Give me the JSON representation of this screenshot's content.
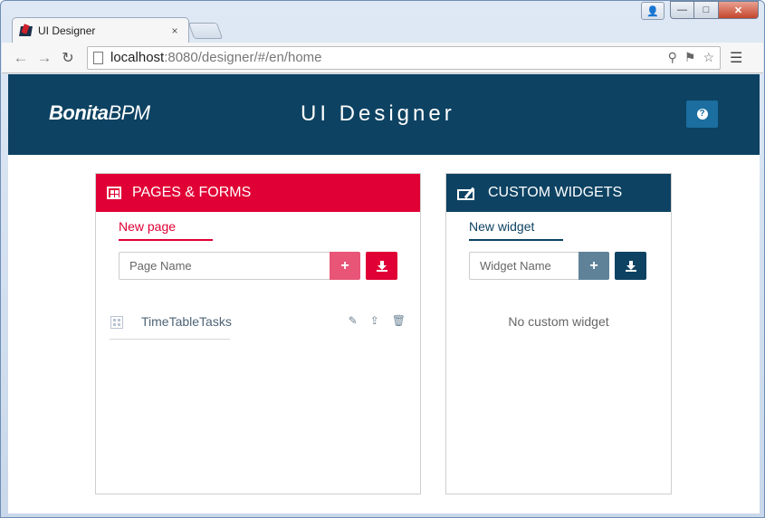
{
  "browser": {
    "tab_title": "UI Designer",
    "tab_close": "×",
    "url_host": "localhost",
    "url_rest": ":8080/designer/#/en/home",
    "window_buttons": {
      "profile": "👤",
      "minimize": "—",
      "maximize": "□",
      "close": "✕"
    },
    "icons": [
      "back-icon",
      "forward-icon",
      "reload-icon",
      "zoom-icon",
      "translate-icon",
      "star-icon",
      "menu-icon"
    ]
  },
  "header": {
    "logo_bold": "Bonita",
    "logo_rest": "BPM",
    "title": "UI Designer",
    "help_glyph": "?"
  },
  "pages": {
    "title": "PAGES & FORMS",
    "tab": "New page",
    "placeholder": "Page Name",
    "add_glyph": "+",
    "items": [
      {
        "name": "TimeTableTasks"
      }
    ]
  },
  "widgets": {
    "title": "CUSTOM WIDGETS",
    "tab": "New widget",
    "placeholder": "Widget Name",
    "add_glyph": "+",
    "empty": "No custom widget"
  },
  "colors": {
    "brand": "#0d4262",
    "pages_accent": "#e00035",
    "help_button": "#1b6e9f"
  }
}
